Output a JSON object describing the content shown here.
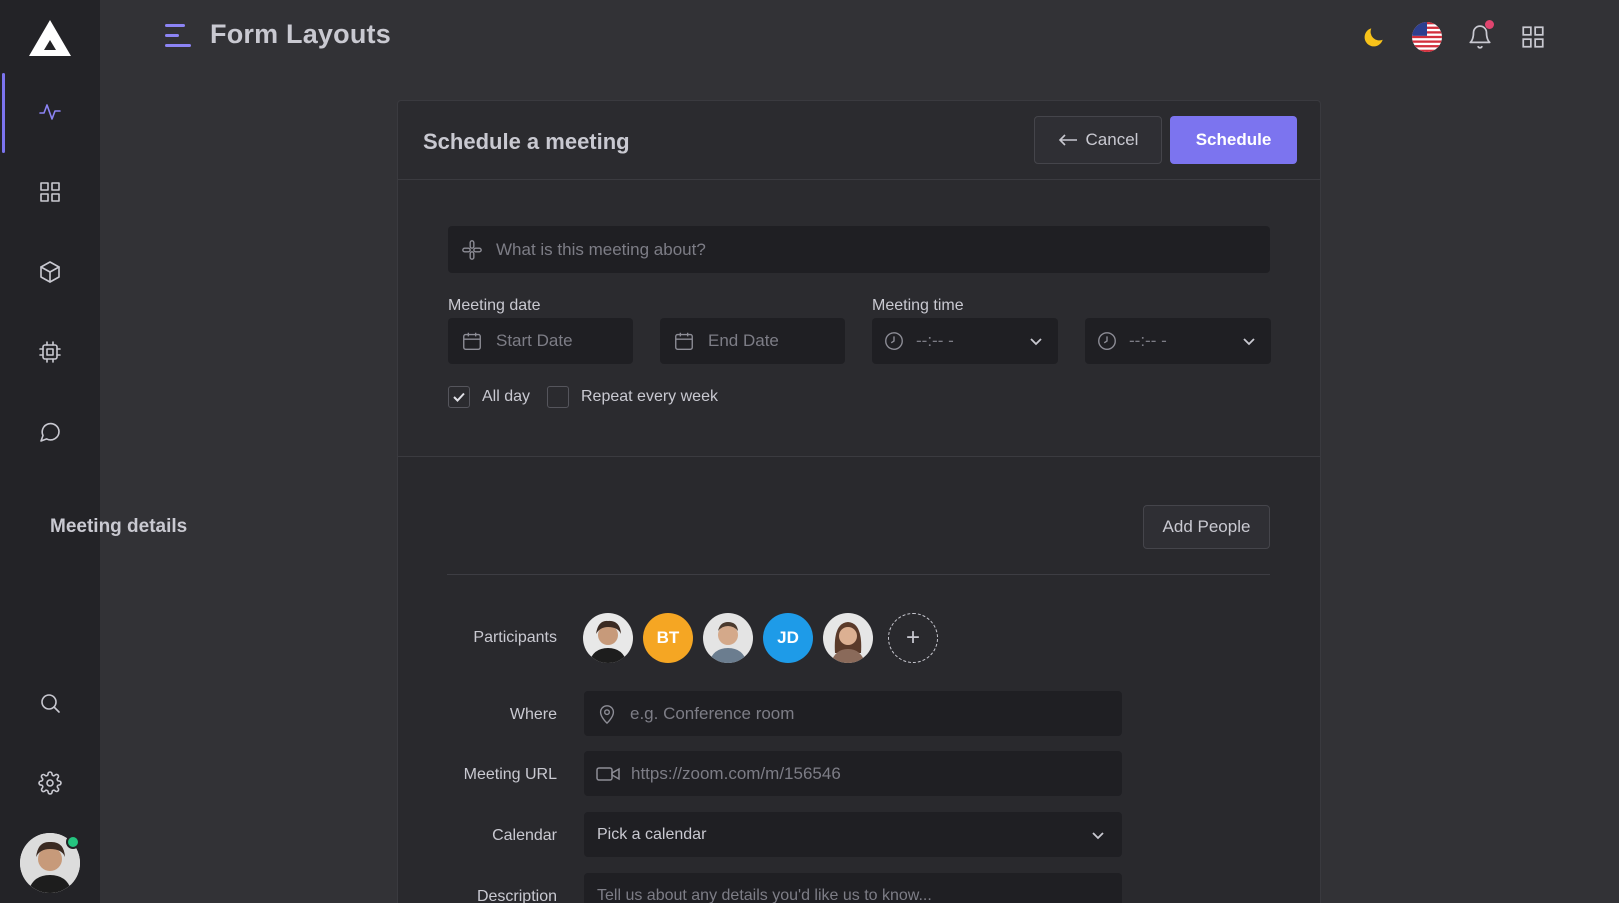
{
  "app": {
    "page_title": "Form Layouts"
  },
  "sidebar": {
    "items": [
      {
        "name": "activity",
        "icon": "activity-icon",
        "active": true
      },
      {
        "name": "grid",
        "icon": "grid-icon",
        "active": false
      },
      {
        "name": "box",
        "icon": "box-icon",
        "active": false
      },
      {
        "name": "chip",
        "icon": "cpu-icon",
        "active": false
      },
      {
        "name": "chat",
        "icon": "message-icon",
        "active": false
      },
      {
        "name": "search",
        "icon": "search-icon",
        "active": false
      },
      {
        "name": "settings",
        "icon": "gear-icon",
        "active": false
      }
    ],
    "user_status": "online"
  },
  "header_icons": [
    "moon-icon",
    "us-flag-icon",
    "bell-icon",
    "apps-grid-icon"
  ],
  "card": {
    "title": "Schedule a meeting",
    "cancel_label": "Cancel",
    "schedule_label": "Schedule",
    "topic_placeholder": "What is this meeting about?",
    "meeting_date_label": "Meeting date",
    "start_date_placeholder": "Start Date",
    "end_date_placeholder": "End Date",
    "meeting_time_label": "Meeting time",
    "start_time_value": "--:-- -",
    "end_time_value": "--:-- -",
    "all_day_label": "All day",
    "all_day_checked": true,
    "repeat_label": "Repeat every week",
    "repeat_checked": false
  },
  "details": {
    "title": "Meeting details",
    "add_people_label": "Add People",
    "participants_label": "Participants",
    "participants": [
      {
        "type": "photo",
        "initials": ""
      },
      {
        "type": "initials",
        "initials": "BT",
        "color": "#f5a623"
      },
      {
        "type": "photo",
        "initials": ""
      },
      {
        "type": "initials",
        "initials": "JD",
        "color": "#1e9be8"
      },
      {
        "type": "photo",
        "initials": ""
      }
    ],
    "add_participant_symbol": "+",
    "where_label": "Where",
    "where_placeholder": "e.g. Conference room",
    "url_label": "Meeting URL",
    "url_placeholder": "https://zoom.com/m/156546",
    "calendar_label": "Calendar",
    "calendar_value": "Pick a calendar",
    "description_label": "Description",
    "description_placeholder": "Tell us about any details you'd like us to know..."
  },
  "colors": {
    "accent": "#7c74ef",
    "background": "#323236",
    "sidebar": "#232327",
    "card": "#2b2b2f",
    "input": "#1f1f23"
  }
}
